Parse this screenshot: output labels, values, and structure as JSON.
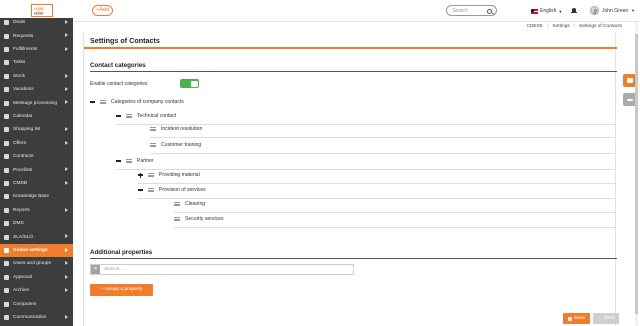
{
  "logo": {
    "line1": "YOUR LOGO",
    "line2": "HERE"
  },
  "header": {
    "add_label": "+Add",
    "search_placeholder": "Search",
    "language": "English",
    "user_name": "John Green"
  },
  "sidebar": {
    "items": [
      {
        "label": "Deals",
        "icon": "deals-icon",
        "arrow": true
      },
      {
        "label": "Requests",
        "icon": "requests-icon",
        "arrow": true
      },
      {
        "label": "Fulfillments",
        "icon": "fulfillments-icon",
        "arrow": true
      },
      {
        "label": "Tasks",
        "icon": "tasks-icon",
        "arrow": false
      },
      {
        "label": "Stock",
        "icon": "stock-icon",
        "arrow": true
      },
      {
        "label": "Vacations",
        "icon": "vacations-icon",
        "arrow": true
      },
      {
        "label": "Message processing",
        "icon": "message-icon",
        "arrow": true
      },
      {
        "label": "Calendar",
        "icon": "calendar-icon",
        "arrow": false
      },
      {
        "label": "Shopping list",
        "icon": "cart-icon",
        "arrow": true
      },
      {
        "label": "Offers",
        "icon": "offers-icon",
        "arrow": true
      },
      {
        "label": "Contracts",
        "icon": "contracts-icon",
        "arrow": false
      },
      {
        "label": "Pricelists",
        "icon": "pricelists-icon",
        "arrow": true
      },
      {
        "label": "CMDB",
        "icon": "cmdb-icon",
        "arrow": true
      },
      {
        "label": "Knowledge Base",
        "icon": "knowledge-base-icon",
        "arrow": false
      },
      {
        "label": "Reports",
        "icon": "reports-icon",
        "arrow": true
      },
      {
        "label": "DMS",
        "icon": "dms-icon",
        "arrow": false
      },
      {
        "label": "SLA/SLO",
        "icon": "sla-icon",
        "arrow": true
      },
      {
        "label": "Global settings",
        "icon": "settings-icon",
        "arrow": true,
        "active": true
      },
      {
        "label": "Users and groups",
        "icon": "users-icon",
        "arrow": true
      },
      {
        "label": "Approval",
        "icon": "approval-icon",
        "arrow": true
      },
      {
        "label": "Archive",
        "icon": "archive-icon",
        "arrow": true
      },
      {
        "label": "Computers",
        "icon": "computers-icon",
        "arrow": false
      },
      {
        "label": "Communication",
        "icon": "communication-icon",
        "arrow": true
      }
    ]
  },
  "breadcrumb": {
    "items": [
      "CDESK",
      "Settings",
      "Settings of Contacts"
    ]
  },
  "page": {
    "title": "Settings of Contacts",
    "contact_categories": {
      "section_title": "Contact categories",
      "toggle_label": "Enable contact categories",
      "toggle_on": true,
      "tree": {
        "root": "Categories of company contacts",
        "technical_contact": "Technical contact",
        "incident_resolution": "Incident resolution",
        "customer_training": "Customer training",
        "partner": "Partner",
        "providing_material": "Providing material",
        "provision_of_services": "Provision of services",
        "cleaning": "Cleaning",
        "security_services": "Security services"
      }
    },
    "additional_properties": {
      "section_title": "Additional properties",
      "search_placeholder": "Search...",
      "assign_label": "+ Assign a property"
    },
    "save_label": "Save",
    "back_label": "← Back"
  },
  "colors": {
    "accent": "#f07d2c",
    "sidebar": "#3d3d3d",
    "toggle": "#4caf50"
  }
}
